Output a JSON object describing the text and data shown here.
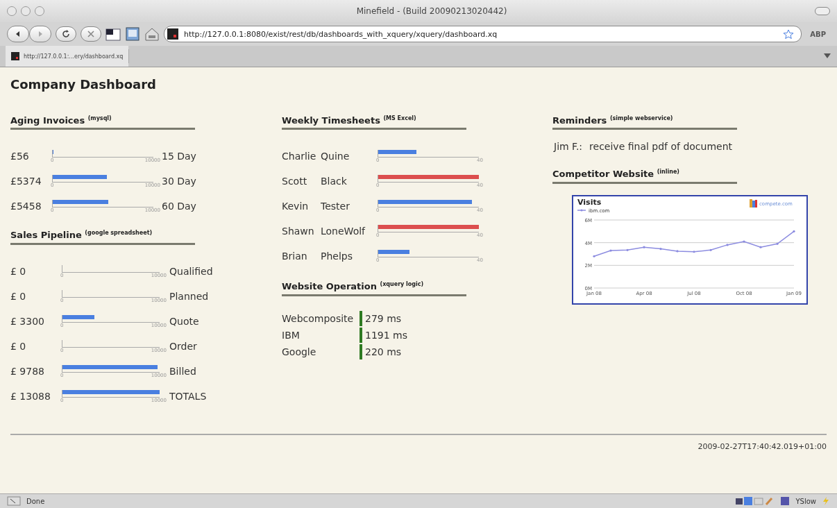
{
  "window": {
    "title": "Minefield - (Build 20090213020442)"
  },
  "toolbar": {
    "url": "http://127.0.0.1:8080/exist/rest/db/dashboards_with_xquery/xquery/dashboard.xq",
    "addon": "ABP"
  },
  "tabs": [
    {
      "label": "http://127.0.0.1:...ery/dashboard.xq",
      "selected": true
    }
  ],
  "page": {
    "title": "Company Dashboard",
    "aging_invoices": {
      "title": "Aging Invoices",
      "source": "(mysql)",
      "rows": [
        {
          "amount": "£56",
          "level": 0.006,
          "min": "0",
          "max": "10000",
          "label": "15 Day"
        },
        {
          "amount": "£5374",
          "level": 0.54,
          "min": "0",
          "max": "10000",
          "label": "30 Day"
        },
        {
          "amount": "£5458",
          "level": 0.55,
          "min": "0",
          "max": "10000",
          "label": "60 Day"
        }
      ]
    },
    "sales_pipeline": {
      "title": "Sales Pipeline",
      "source": "(google spreadsheet)",
      "rows": [
        {
          "amount": "£ 0",
          "level": 0,
          "min": "0",
          "max": "10000",
          "label": "Qualified"
        },
        {
          "amount": "£ 0",
          "level": 0,
          "min": "0",
          "max": "10000",
          "label": "Planned"
        },
        {
          "amount": "£ 3300",
          "level": 0.33,
          "min": "0",
          "max": "10000",
          "label": "Quote"
        },
        {
          "amount": "£ 0",
          "level": 0,
          "min": "0",
          "max": "10000",
          "label": "Order"
        },
        {
          "amount": "£ 9788",
          "level": 0.98,
          "min": "0",
          "max": "10000",
          "label": "Billed"
        },
        {
          "amount": "£ 13088",
          "level": 1,
          "min": "0",
          "max": "10000",
          "label": "TOTALS"
        }
      ]
    },
    "weekly_timesheets": {
      "title": "Weekly Timesheets",
      "source": "(MS Excel)",
      "rows": [
        {
          "first": "Charlie",
          "last": "Quine",
          "level": 0.38,
          "color": "#4a7fe0",
          "min": "0",
          "max": "40"
        },
        {
          "first": "Scott",
          "last": "Black",
          "level": 1,
          "color": "#dc4e4e",
          "min": "0",
          "max": "40"
        },
        {
          "first": "Kevin",
          "last": "Tester",
          "level": 0.93,
          "color": "#4a7fe0",
          "min": "0",
          "max": "40"
        },
        {
          "first": "Shawn",
          "last": "LoneWolf",
          "level": 1,
          "color": "#dc4e4e",
          "min": "0",
          "max": "40"
        },
        {
          "first": "Brian",
          "last": "Phelps",
          "level": 0.31,
          "color": "#4a7fe0",
          "min": "0",
          "max": "40"
        }
      ]
    },
    "website_operation": {
      "title": "Website Operation",
      "source": "(xquery logic)",
      "rows": [
        {
          "site": "Webcomposite",
          "time": "279 ms"
        },
        {
          "site": "IBM",
          "time": "1191 ms"
        },
        {
          "site": "Google",
          "time": "220 ms"
        }
      ]
    },
    "reminders": {
      "title": "Reminders",
      "source": "(simple webservice)",
      "items": [
        {
          "who": "Jim F.:",
          "text": "receive final pdf of document"
        }
      ]
    },
    "competitor_website": {
      "title": "Competitor Website",
      "source": "(inline)",
      "logo": "compete.com",
      "chart_data": {
        "type": "line",
        "title": "Visits",
        "categories": [
          "Jan 08",
          null,
          null,
          "Apr 08",
          null,
          null,
          "Jul 08",
          null,
          null,
          "Oct 08",
          null,
          null,
          "Jan 09"
        ],
        "series": [
          {
            "name": "ibm.com",
            "color": "#8c8ce0",
            "values": [
              2.8,
              3.3,
              3.35,
              3.6,
              3.45,
              3.25,
              3.2,
              3.35,
              3.8,
              4.1,
              3.6,
              3.9,
              5.0
            ]
          }
        ],
        "ylim": [
          0,
          6
        ],
        "yticks": [
          {
            "value": 0,
            "label": "0M"
          },
          {
            "value": 2,
            "label": "2M"
          },
          {
            "value": 4,
            "label": "4M"
          },
          {
            "value": 6,
            "label": "6M"
          }
        ]
      }
    },
    "timestamp": "2009-02-27T17:40:42.019+01:00"
  },
  "status_bar": {
    "text": "Done",
    "addon": "YSlow"
  }
}
